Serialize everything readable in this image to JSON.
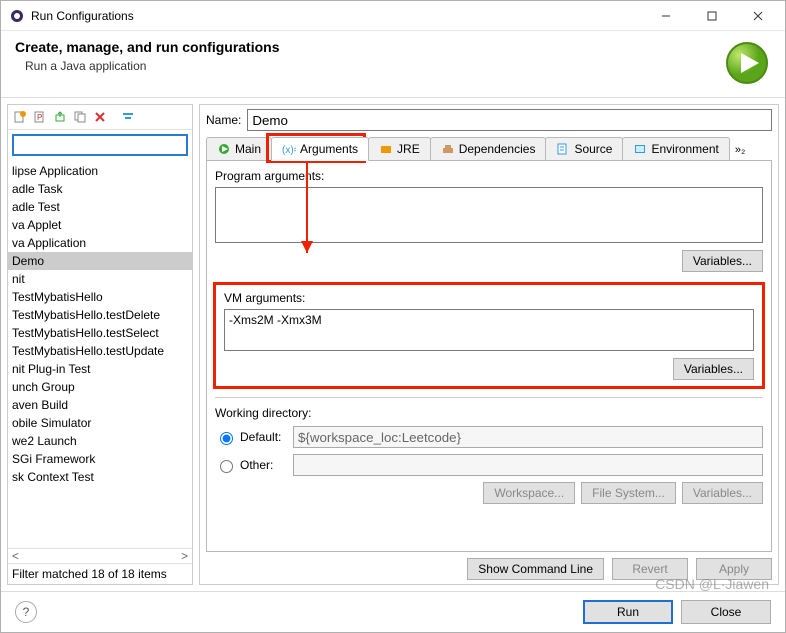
{
  "window": {
    "title": "Run Configurations"
  },
  "header": {
    "title": "Create, manage, and run configurations",
    "subtitle": "Run a Java application"
  },
  "name_label": "Name:",
  "name_value": "Demo",
  "tabs": {
    "main": "Main",
    "arguments": "Arguments",
    "jre": "JRE",
    "dependencies": "Dependencies",
    "source": "Source",
    "environment": "Environment",
    "overflow": "»₂"
  },
  "program_args": {
    "label": "Program arguments:",
    "value": "",
    "variables": "Variables..."
  },
  "vm_args": {
    "label": "VM arguments:",
    "value": "-Xms2M -Xmx3M",
    "variables": "Variables..."
  },
  "working_dir": {
    "label": "Working directory:",
    "default_label": "Default:",
    "default_value": "${workspace_loc:Leetcode}",
    "other_label": "Other:",
    "workspace": "Workspace...",
    "filesystem": "File System...",
    "variables": "Variables..."
  },
  "actions": {
    "show_cmd": "Show Command Line",
    "revert": "Revert",
    "apply": "Apply"
  },
  "footer": {
    "run": "Run",
    "close": "Close"
  },
  "filter_text": "Filter matched 18 of 18 items",
  "tree": {
    "items": [
      "lipse Application",
      "adle Task",
      "adle Test",
      "va Applet",
      "va Application",
      "Demo",
      "nit",
      "TestMybatisHello",
      "TestMybatisHello.testDelete",
      "TestMybatisHello.testSelect",
      "TestMybatisHello.testUpdate",
      "nit Plug-in Test",
      "unch Group",
      "aven Build",
      "obile Simulator",
      "we2 Launch",
      "SGi Framework",
      "sk Context Test"
    ],
    "selected_index": 5
  },
  "watermark": "CSDN @L·Jiawen"
}
